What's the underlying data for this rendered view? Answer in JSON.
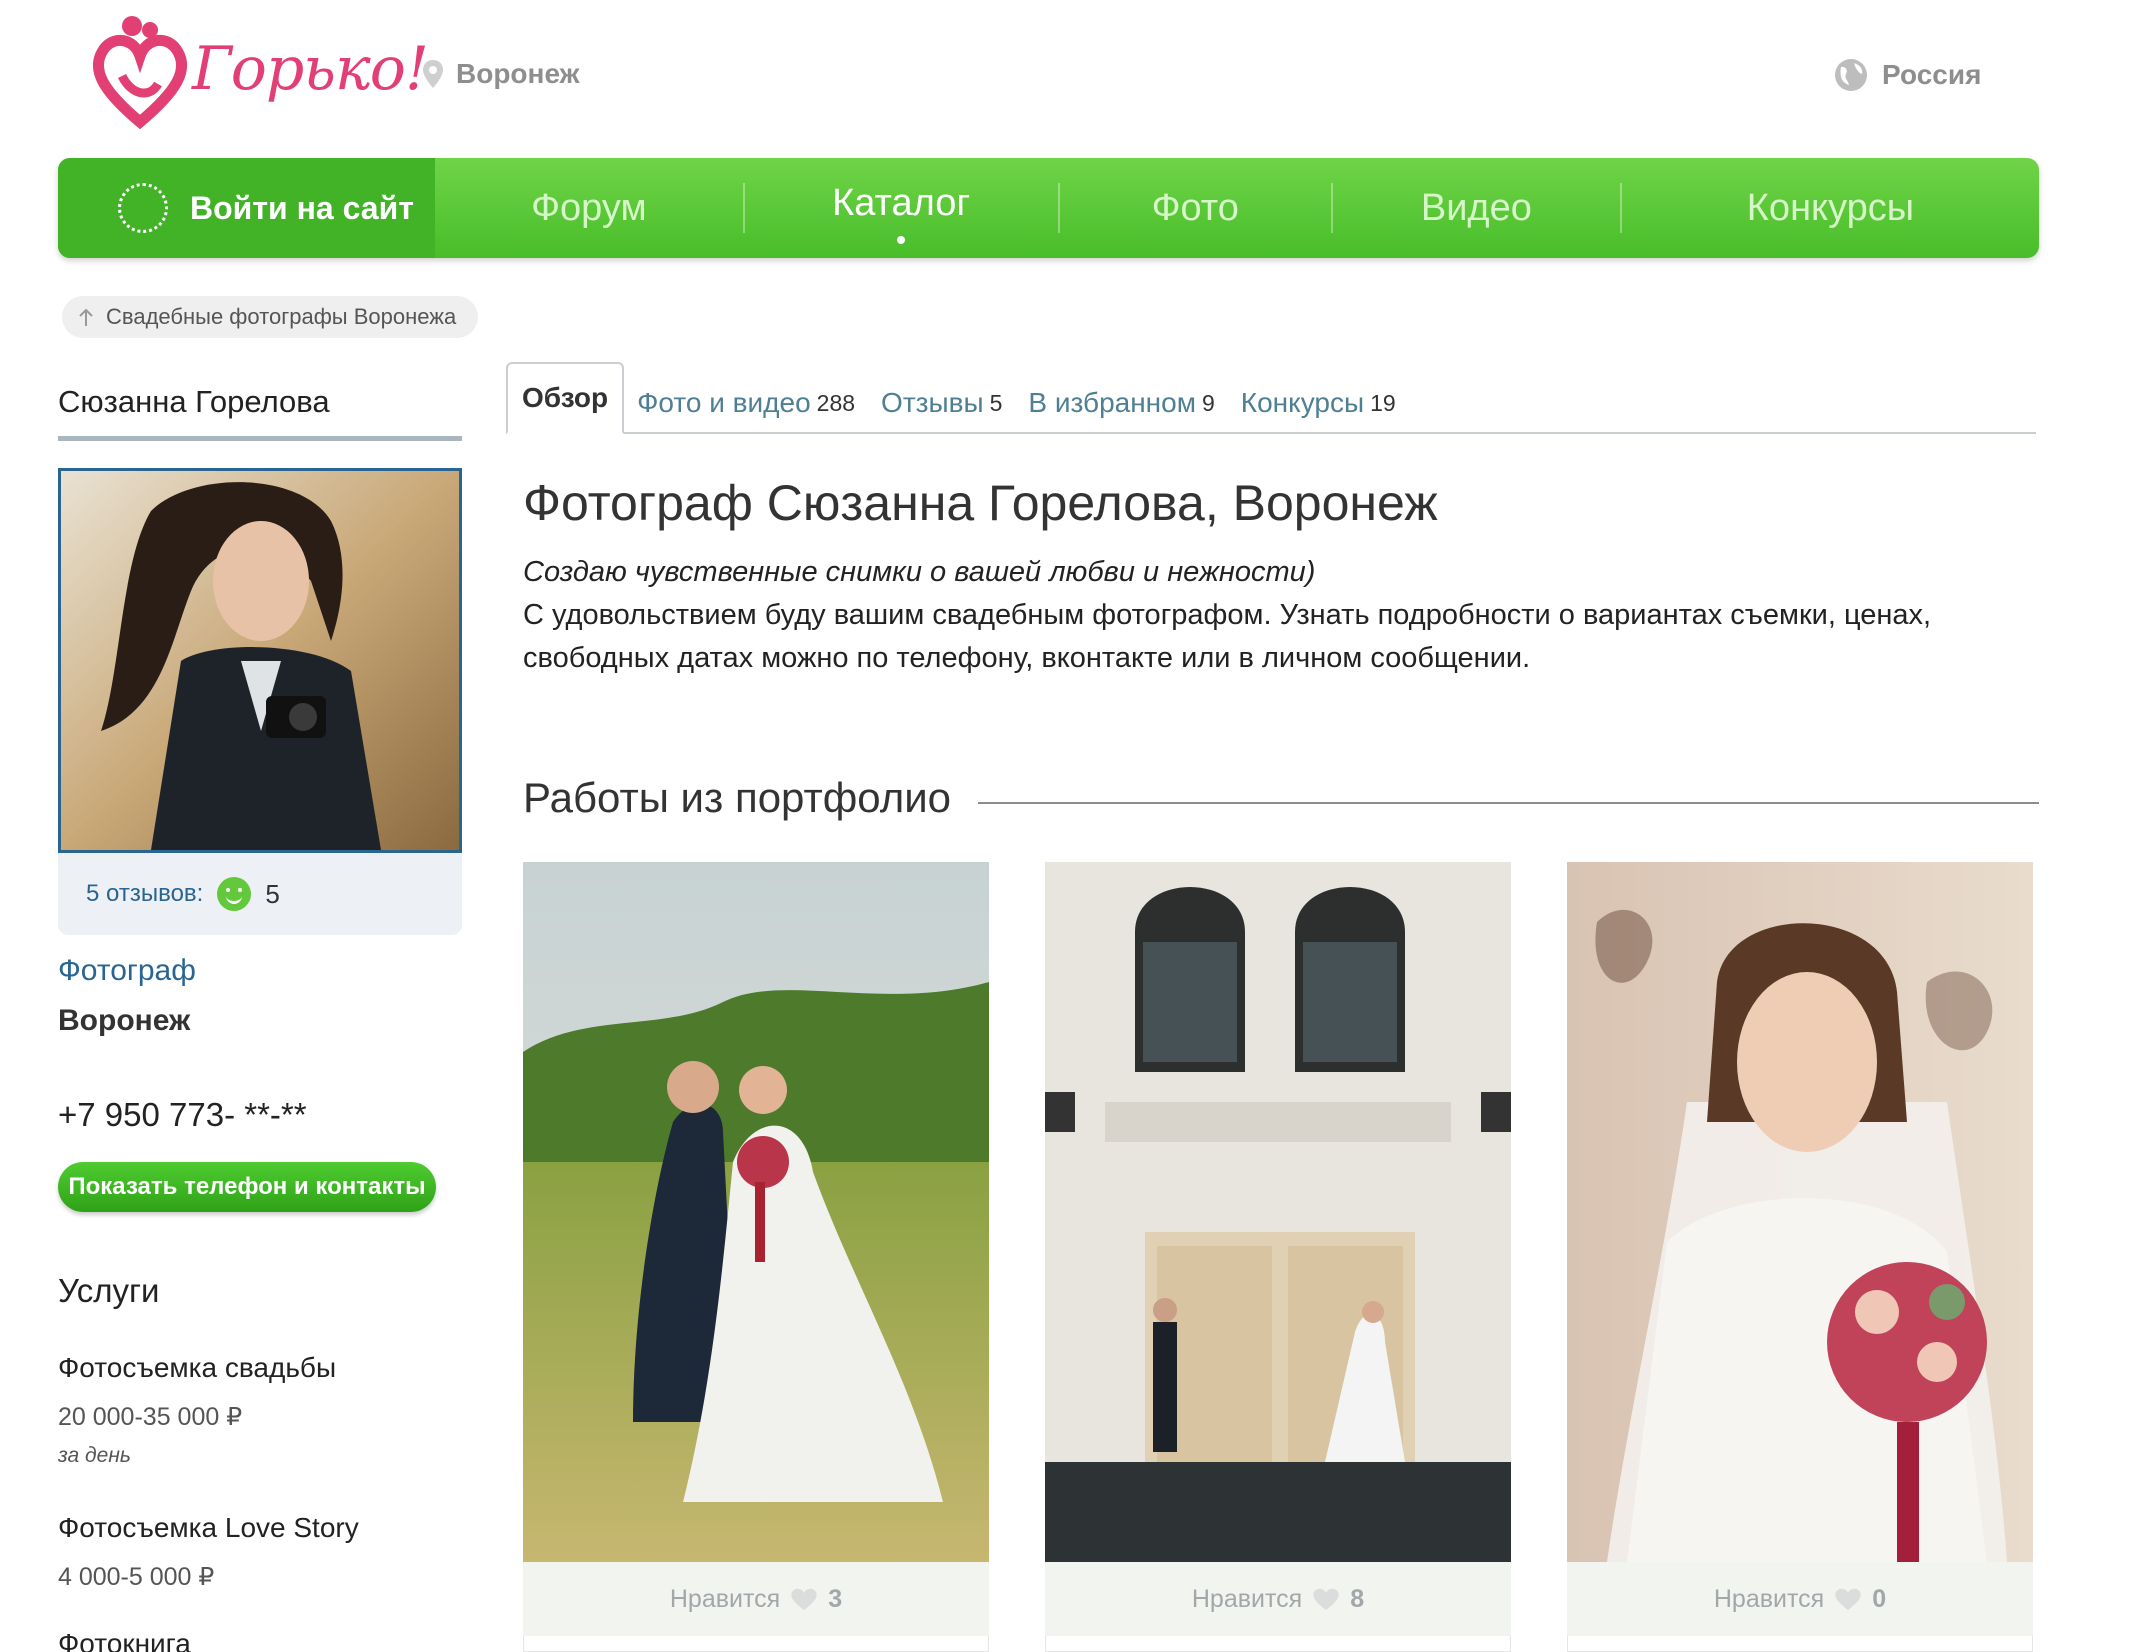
{
  "header": {
    "logo_text": "Горько!",
    "city": "Воронеж",
    "country": "Россия"
  },
  "nav": {
    "login": "Войти на сайт",
    "items": [
      "Форум",
      "Каталог",
      "Фото",
      "Видео",
      "Конкурсы"
    ],
    "active": "Каталог"
  },
  "breadcrumb": "Свадебные фотографы Воронежа",
  "profile": {
    "name": "Сюзанна Горелова",
    "reviews_link": "5 отзывов:",
    "rating_count": "5",
    "type": "Фотограф",
    "city": "Воронеж",
    "phone": "+7 950 773- **-**",
    "show_phone_button": "Показать телефон и контакты"
  },
  "services": {
    "title": "Услуги",
    "items": [
      {
        "name": "Фотосъемка свадьбы",
        "price": "20 000-35 000 ₽",
        "unit": "за день"
      },
      {
        "name": "Фотосъемка Love Story",
        "price": "4 000-5 000 ₽",
        "unit": ""
      },
      {
        "name": "Фотокнига",
        "price": "",
        "unit": ""
      }
    ]
  },
  "tabs": [
    {
      "label": "Обзор",
      "count": ""
    },
    {
      "label": "Фото и видео",
      "count": "288"
    },
    {
      "label": "Отзывы",
      "count": "5"
    },
    {
      "label": "В избранном",
      "count": "9"
    },
    {
      "label": "Конкурсы",
      "count": "19"
    }
  ],
  "main": {
    "title": "Фотограф Сюзанна Горелова, Воронеж",
    "tagline": "Создаю чувственные снимки о вашей любви и нежности)",
    "description": "С удовольствием буду вашим свадебным фотографом. Узнать подробности о вариантах съемки, ценах, свободных датах можно по телефону, вконтакте или в личном сообщении.",
    "portfolio_title": "Работы из портфолио"
  },
  "portfolio": [
    {
      "like_label": "Нравится",
      "likes": "3"
    },
    {
      "like_label": "Нравится",
      "likes": "8"
    },
    {
      "like_label": "Нравится",
      "likes": "0"
    }
  ],
  "colors": {
    "brand_pink": "#e23f74",
    "nav_green": "#55c532",
    "link_blue": "#2a6592",
    "button_green": "#3ab521"
  },
  "icons": [
    "heart-logo-icon",
    "location-pin-icon",
    "globe-icon",
    "dotted-circle-icon",
    "arrow-up-icon",
    "smile-icon",
    "heart-icon"
  ]
}
